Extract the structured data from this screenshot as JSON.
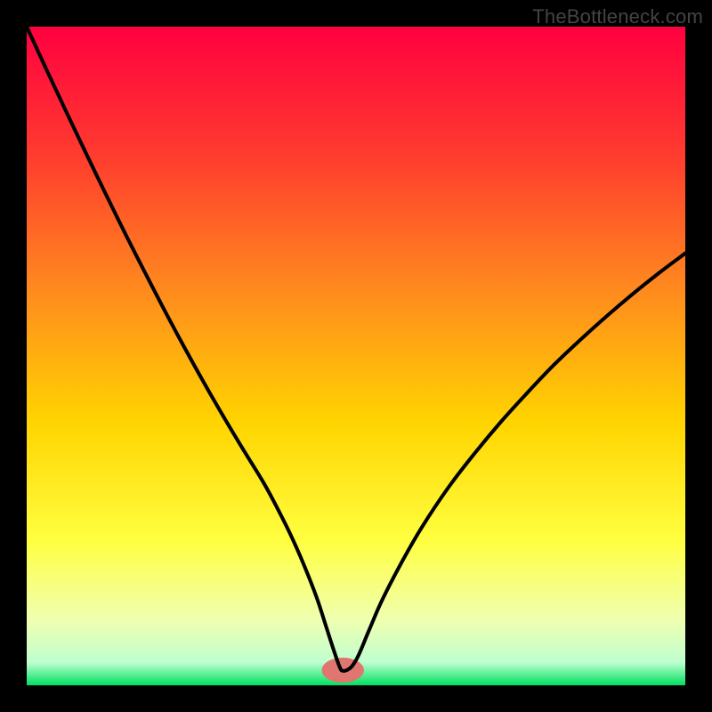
{
  "watermark": "TheBottleneck.com",
  "chart_data": {
    "type": "line",
    "title": "",
    "xlabel": "",
    "ylabel": "",
    "xlim": [
      0,
      100
    ],
    "ylim": [
      0,
      100
    ],
    "background_gradient": {
      "stops": [
        {
          "offset": 0.0,
          "color": "#ff0040"
        },
        {
          "offset": 0.2,
          "color": "#ff3d2e"
        },
        {
          "offset": 0.4,
          "color": "#ff8a1e"
        },
        {
          "offset": 0.6,
          "color": "#ffd400"
        },
        {
          "offset": 0.78,
          "color": "#ffff40"
        },
        {
          "offset": 0.9,
          "color": "#f0ffb0"
        },
        {
          "offset": 0.965,
          "color": "#bfffd0"
        },
        {
          "offset": 1.0,
          "color": "#00e060"
        }
      ]
    },
    "marker": {
      "x": 48,
      "y": 2.3,
      "color": "#e0766f",
      "rx": 3.2,
      "ry": 1.9
    },
    "series": [
      {
        "name": "curve",
        "color": "#000000",
        "points": [
          {
            "x": 0.0,
            "y": 100.0
          },
          {
            "x": 3.0,
            "y": 93.5
          },
          {
            "x": 6.0,
            "y": 87.1
          },
          {
            "x": 9.0,
            "y": 80.8
          },
          {
            "x": 12.0,
            "y": 74.6
          },
          {
            "x": 15.0,
            "y": 68.5
          },
          {
            "x": 18.0,
            "y": 62.6
          },
          {
            "x": 21.0,
            "y": 56.8
          },
          {
            "x": 24.0,
            "y": 51.2
          },
          {
            "x": 27.0,
            "y": 45.8
          },
          {
            "x": 30.0,
            "y": 40.6
          },
          {
            "x": 33.0,
            "y": 35.6
          },
          {
            "x": 36.0,
            "y": 30.7
          },
          {
            "x": 38.0,
            "y": 27.0
          },
          {
            "x": 40.0,
            "y": 23.0
          },
          {
            "x": 42.0,
            "y": 18.5
          },
          {
            "x": 44.0,
            "y": 13.4
          },
          {
            "x": 45.5,
            "y": 8.8
          },
          {
            "x": 46.8,
            "y": 4.8
          },
          {
            "x": 47.6,
            "y": 2.6
          },
          {
            "x": 48.0,
            "y": 2.2
          },
          {
            "x": 48.6,
            "y": 2.3
          },
          {
            "x": 49.4,
            "y": 2.9
          },
          {
            "x": 50.4,
            "y": 4.6
          },
          {
            "x": 52.0,
            "y": 8.4
          },
          {
            "x": 54.0,
            "y": 13.0
          },
          {
            "x": 57.0,
            "y": 18.8
          },
          {
            "x": 60.0,
            "y": 24.0
          },
          {
            "x": 64.0,
            "y": 30.0
          },
          {
            "x": 68.0,
            "y": 35.2
          },
          {
            "x": 72.0,
            "y": 40.0
          },
          {
            "x": 76.0,
            "y": 44.4
          },
          {
            "x": 80.0,
            "y": 48.6
          },
          {
            "x": 84.0,
            "y": 52.4
          },
          {
            "x": 88.0,
            "y": 56.0
          },
          {
            "x": 92.0,
            "y": 59.4
          },
          {
            "x": 96.0,
            "y": 62.6
          },
          {
            "x": 100.0,
            "y": 65.6
          }
        ]
      }
    ]
  }
}
